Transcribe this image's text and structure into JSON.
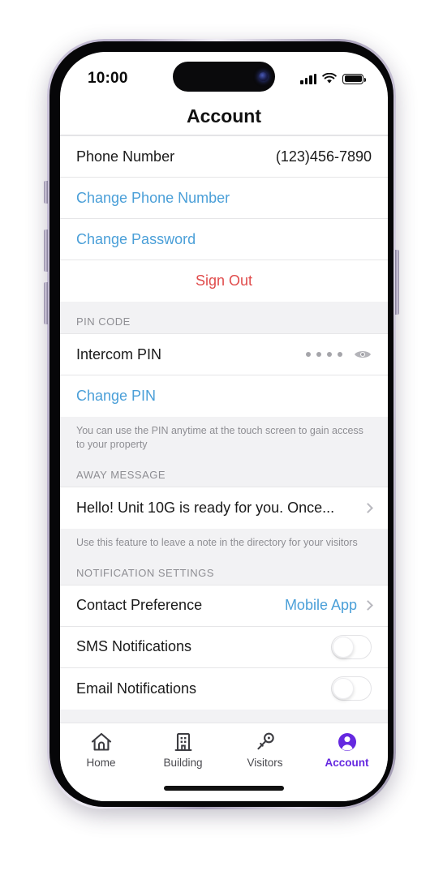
{
  "status_bar": {
    "time": "10:00",
    "signal_icon": "cellular-bars-icon",
    "wifi_icon": "wifi-icon",
    "battery_icon": "battery-full-icon"
  },
  "header": {
    "title": "Account"
  },
  "account_section": {
    "phone_label": "Phone Number",
    "phone_value": "(123)456-7890",
    "change_phone_label": "Change Phone Number",
    "change_password_label": "Change Password",
    "sign_out_label": "Sign Out"
  },
  "pin_section": {
    "header": "PIN CODE",
    "pin_label": "Intercom PIN",
    "pin_masked": "••••",
    "reveal_icon": "eye-icon",
    "change_pin_label": "Change PIN",
    "footer": "You can use the PIN anytime at the touch screen to gain access to your property"
  },
  "away_section": {
    "header": "AWAY MESSAGE",
    "message": "Hello! Unit 10G is ready for you. Once...",
    "chevron_icon": "chevron-right-icon",
    "footer": "Use this feature to leave a note in the directory for your visitors"
  },
  "notification_section": {
    "header": "NOTIFICATION SETTINGS",
    "contact_preference_label": "Contact Preference",
    "contact_preference_value": "Mobile App",
    "sms_label": "SMS Notifications",
    "sms_enabled": false,
    "email_label": "Email Notifications",
    "email_enabled": false
  },
  "tabbar": {
    "items": [
      {
        "label": "Home",
        "icon": "home-icon",
        "active": false
      },
      {
        "label": "Building",
        "icon": "building-icon",
        "active": false
      },
      {
        "label": "Visitors",
        "icon": "key-icon",
        "active": false
      },
      {
        "label": "Account",
        "icon": "person-circle-icon",
        "active": true
      }
    ]
  },
  "colors": {
    "link_blue": "#4a9fd8",
    "danger_red": "#e04c4c",
    "accent_purple": "#6528e0",
    "group_bg": "#f2f2f4"
  }
}
